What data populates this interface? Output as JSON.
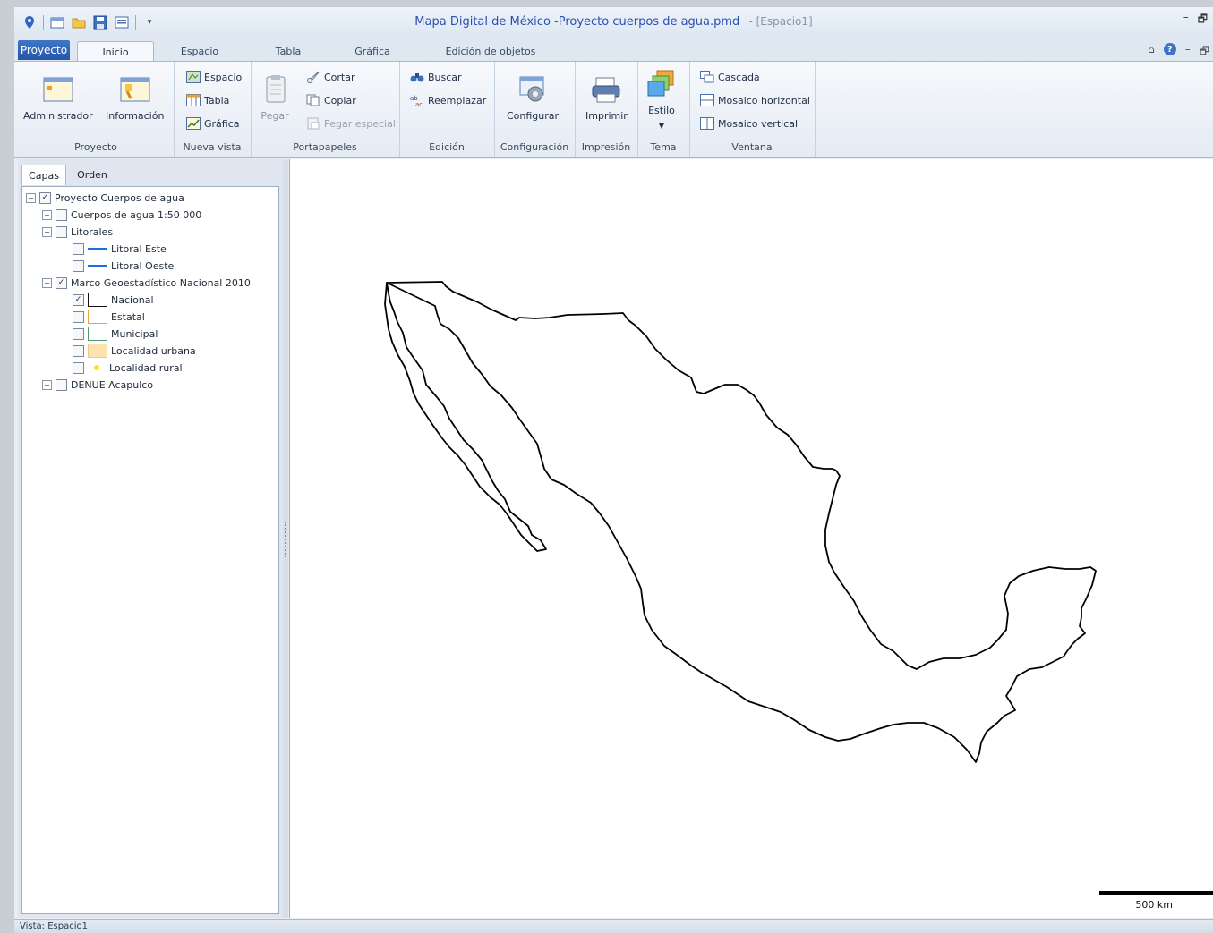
{
  "window": {
    "title": "Mapa Digital de México -Proyecto cuerpos de agua.pmd",
    "subtitle": "- [Espacio1]"
  },
  "tabs": {
    "proyecto": "Proyecto",
    "inicio": "Inicio",
    "espacio": "Espacio",
    "tabla": "Tabla",
    "grafica": "Gráfica",
    "edicion": "Edición de objetos"
  },
  "ribbon": {
    "proyecto": {
      "label": "Proyecto",
      "administrador": "Administrador",
      "informacion": "Información"
    },
    "nueva_vista": {
      "label": "Nueva vista",
      "espacio": "Espacio",
      "tabla": "Tabla",
      "grafica": "Gráfica"
    },
    "portapapeles": {
      "label": "Portapapeles",
      "pegar": "Pegar",
      "cortar": "Cortar",
      "copiar": "Copiar",
      "pegar_especial": "Pegar especial"
    },
    "edicion": {
      "label": "Edición",
      "buscar": "Buscar",
      "reemplazar": "Reemplazar"
    },
    "configuracion": {
      "label": "Configuración",
      "configurar": "Configurar"
    },
    "impresion": {
      "label": "Impresión",
      "imprimir": "Imprimir"
    },
    "tema": {
      "label": "Tema",
      "estilo": "Estilo"
    },
    "ventana": {
      "label": "Ventana",
      "cascada": "Cascada",
      "mosaico_horizontal": "Mosaico horizontal",
      "mosaico_vertical": "Mosaico vertical"
    }
  },
  "panel": {
    "tabs": {
      "capas": "Capas",
      "orden": "Orden"
    },
    "layers": [
      {
        "label": "Proyecto Cuerpos de agua",
        "checked": true,
        "expander": "−"
      },
      {
        "label": "Cuerpos de agua 1:50 000",
        "checked": false,
        "expander": "+"
      },
      {
        "label": "Litorales",
        "checked": false,
        "expander": "−"
      },
      {
        "label": "Litoral Este",
        "checked": false
      },
      {
        "label": "Litoral Oeste",
        "checked": false
      },
      {
        "label": "Marco Geoestadístico Nacional 2010",
        "checked": true,
        "expander": "−"
      },
      {
        "label": "Nacional",
        "checked": true
      },
      {
        "label": "Estatal",
        "checked": false
      },
      {
        "label": "Municipal",
        "checked": false
      },
      {
        "label": "Localidad urbana",
        "checked": false
      },
      {
        "label": "Localidad rural",
        "checked": false
      },
      {
        "label": "DENUE Acapulco",
        "checked": false,
        "expander": "+"
      }
    ]
  },
  "map": {
    "scale_label": "500 km"
  },
  "status": {
    "text": "Vista: Espacio1"
  }
}
